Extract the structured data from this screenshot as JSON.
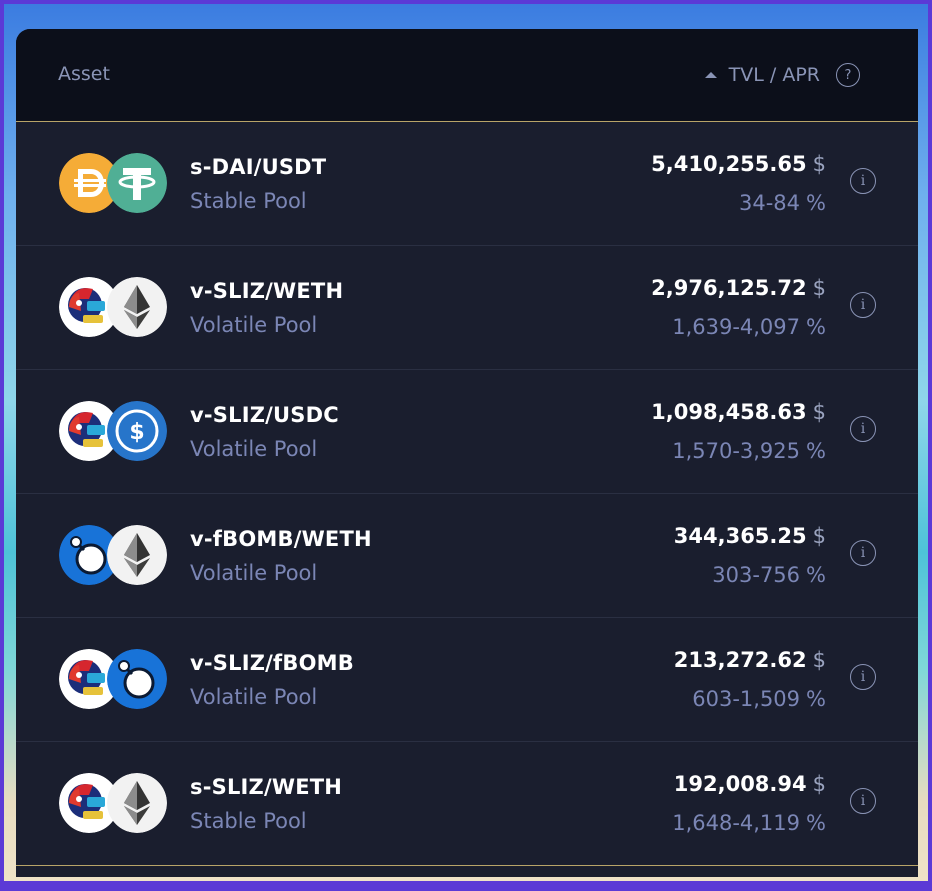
{
  "header": {
    "asset_label": "Asset",
    "sort_label": "TVL / APR",
    "help_label": "?"
  },
  "rows": [
    {
      "pair": "s-DAI/USDT",
      "pool": "Stable Pool",
      "tvl": "5,410,255.65",
      "tvl_unit": "$",
      "apr": "34-84",
      "apr_unit": "%",
      "icon_a": "dai-icon",
      "icon_b": "usdt-icon"
    },
    {
      "pair": "v-SLIZ/WETH",
      "pool": "Volatile Pool",
      "tvl": "2,976,125.72",
      "tvl_unit": "$",
      "apr": "1,639-4,097",
      "apr_unit": "%",
      "icon_a": "sliz-icon",
      "icon_b": "weth-icon"
    },
    {
      "pair": "v-SLIZ/USDC",
      "pool": "Volatile Pool",
      "tvl": "1,098,458.63",
      "tvl_unit": "$",
      "apr": "1,570-3,925",
      "apr_unit": "%",
      "icon_a": "sliz-icon",
      "icon_b": "usdc-icon"
    },
    {
      "pair": "v-fBOMB/WETH",
      "pool": "Volatile Pool",
      "tvl": "344,365.25",
      "tvl_unit": "$",
      "apr": "303-756",
      "apr_unit": "%",
      "icon_a": "fbomb-icon",
      "icon_b": "weth-icon"
    },
    {
      "pair": "v-SLIZ/fBOMB",
      "pool": "Volatile Pool",
      "tvl": "213,272.62",
      "tvl_unit": "$",
      "apr": "603-1,509",
      "apr_unit": "%",
      "icon_a": "sliz-icon",
      "icon_b": "fbomb-icon"
    },
    {
      "pair": "s-SLIZ/WETH",
      "pool": "Stable Pool",
      "tvl": "192,008.94",
      "tvl_unit": "$",
      "apr": "1,648-4,119",
      "apr_unit": "%",
      "icon_a": "sliz-icon",
      "icon_b": "weth-icon"
    }
  ],
  "info_label": "i",
  "colors": {
    "panel_bg": "#1a1e2e",
    "header_bg": "#0c0f1a",
    "accent_border": "#b8a468",
    "muted_text": "#7b86b5"
  }
}
